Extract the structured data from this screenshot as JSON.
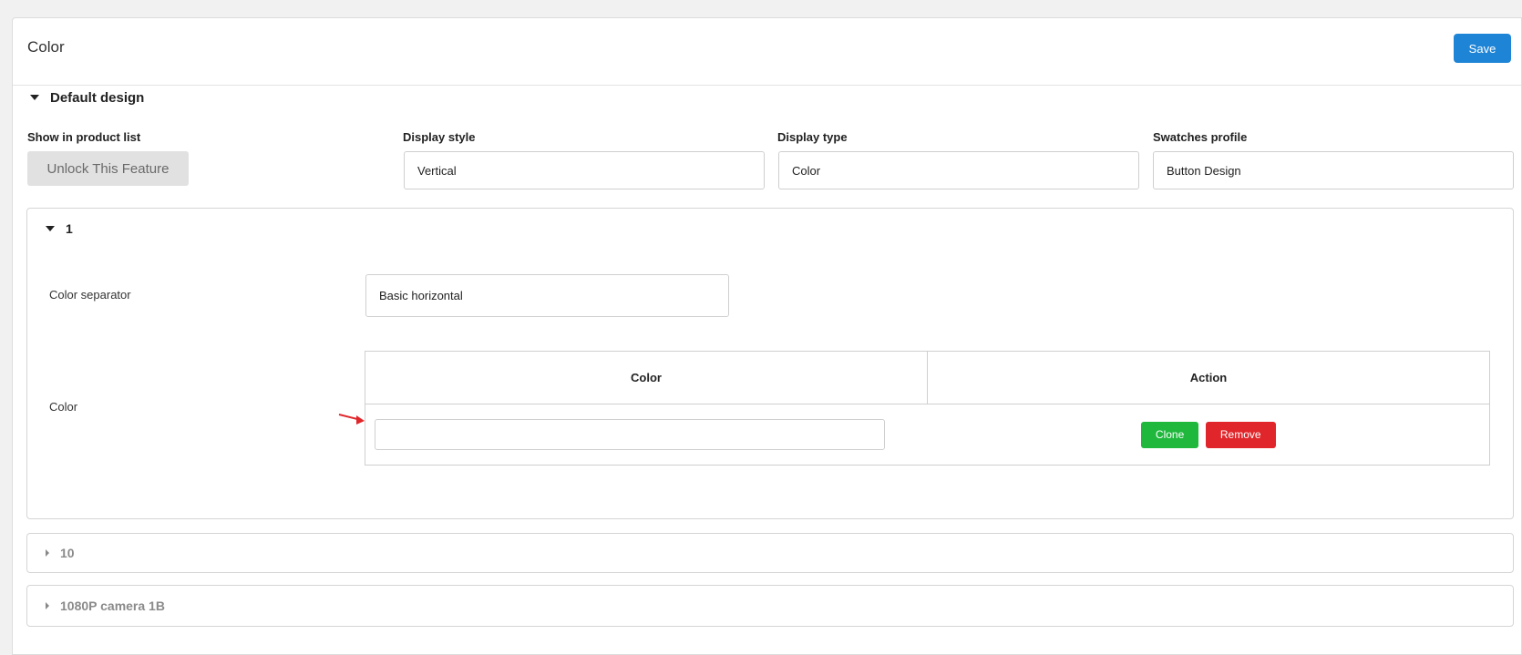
{
  "header": {
    "title": "Color",
    "save_label": "Save"
  },
  "section": {
    "title": "Default design"
  },
  "fields": {
    "show_in_product_list": {
      "label": "Show in product list",
      "button": "Unlock This Feature"
    },
    "display_style": {
      "label": "Display style",
      "value": "Vertical"
    },
    "display_type": {
      "label": "Display type",
      "value": "Color"
    },
    "swatches_profile": {
      "label": "Swatches profile",
      "value": "Button Design"
    }
  },
  "groups": [
    {
      "title": "1",
      "expanded": true,
      "color_separator": {
        "label": "Color separator",
        "value": "Basic horizontal"
      },
      "color": {
        "label": "Color",
        "table": {
          "headers": [
            "Color",
            "Action"
          ],
          "rows": [
            {
              "value": "",
              "actions": [
                "Clone",
                "Remove"
              ]
            }
          ]
        }
      }
    },
    {
      "title": "10",
      "expanded": false
    },
    {
      "title": "1080P camera 1B",
      "expanded": false
    }
  ],
  "colors": {
    "accent": "#1e85d6",
    "clone": "#1fb83d",
    "remove": "#e0262b",
    "annotation_arrow": "#e0262b"
  }
}
